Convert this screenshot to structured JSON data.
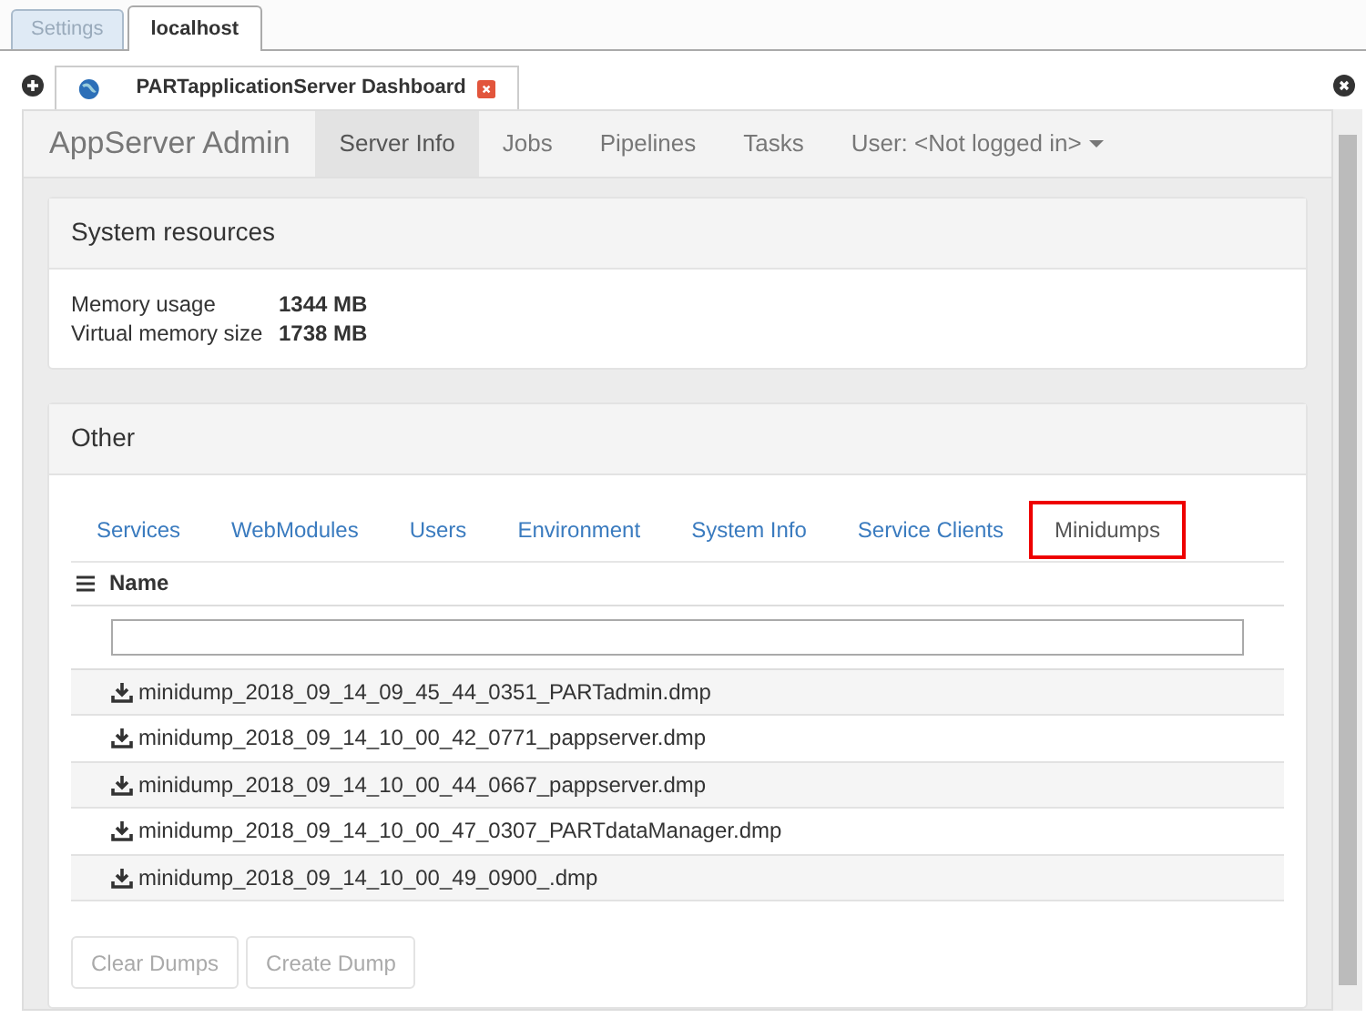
{
  "outer_tabs": [
    {
      "label": "Settings",
      "selected": false
    },
    {
      "label": "localhost",
      "selected": true
    }
  ],
  "doc_tab": {
    "title": "PARTapplicationServer Dashboard"
  },
  "navbar": {
    "brand": "AppServer Admin",
    "items": [
      {
        "label": "Server Info",
        "selected": true
      },
      {
        "label": "Jobs",
        "selected": false
      },
      {
        "label": "Pipelines",
        "selected": false
      },
      {
        "label": "Tasks",
        "selected": false
      }
    ],
    "user_menu": "User: <Not logged in>"
  },
  "system_resources": {
    "title": "System resources",
    "rows": [
      {
        "label": "Memory usage",
        "value": "1344 MB"
      },
      {
        "label": "Virtual memory size",
        "value": "1738 MB"
      }
    ]
  },
  "other": {
    "title": "Other",
    "tabs": [
      {
        "label": "Services",
        "selected": false
      },
      {
        "label": "WebModules",
        "selected": false
      },
      {
        "label": "Users",
        "selected": false
      },
      {
        "label": "Environment",
        "selected": false
      },
      {
        "label": "System Info",
        "selected": false
      },
      {
        "label": "Service Clients",
        "selected": false
      },
      {
        "label": "Minidumps",
        "selected": true
      }
    ],
    "table": {
      "column": "Name",
      "rows": [
        "minidump_2018_09_14_09_45_44_0351_PARTadmin.dmp",
        "minidump_2018_09_14_10_00_42_0771_pappserver.dmp",
        "minidump_2018_09_14_10_00_44_0667_pappserver.dmp",
        "minidump_2018_09_14_10_00_47_0307_PARTdataManager.dmp",
        "minidump_2018_09_14_10_00_49_0900_.dmp"
      ]
    },
    "buttons": [
      {
        "label": "Clear Dumps",
        "disabled": true
      },
      {
        "label": "Create Dump",
        "disabled": true
      }
    ]
  }
}
